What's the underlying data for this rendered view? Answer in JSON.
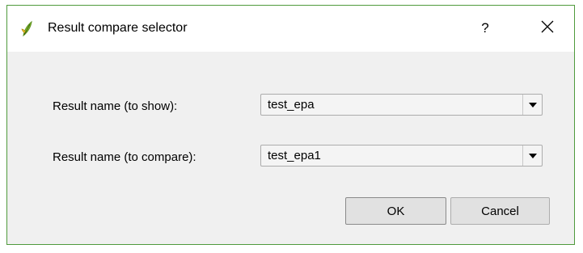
{
  "window": {
    "title": "Result compare selector",
    "help_label": "?",
    "close_glyph": "✕",
    "icon": "qgis-logo-icon",
    "border_color": "#4f9a3c"
  },
  "form": {
    "show_label": "Result name (to show):",
    "show_value": "test_epa",
    "compare_label": "Result name (to compare):",
    "compare_value": "test_epa1"
  },
  "buttons": {
    "ok_label": "OK",
    "cancel_label": "Cancel"
  }
}
